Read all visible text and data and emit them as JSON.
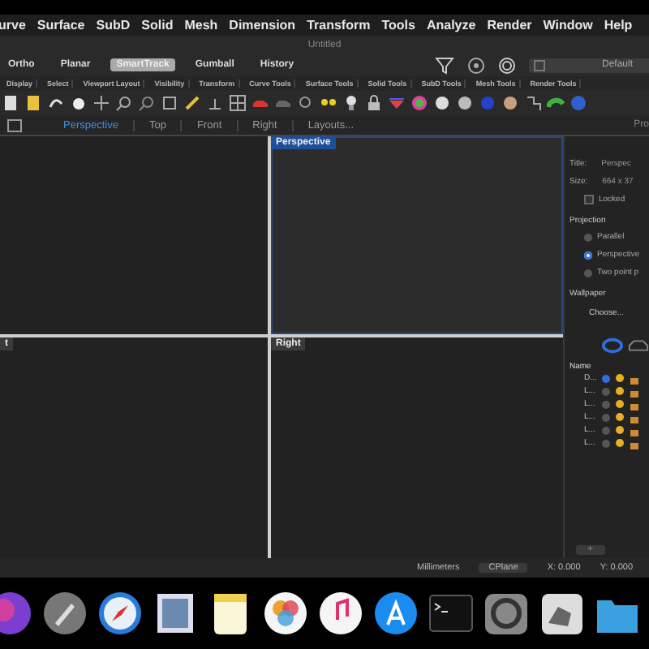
{
  "menu": [
    "urve",
    "Surface",
    "SubD",
    "Solid",
    "Mesh",
    "Dimension",
    "Transform",
    "Tools",
    "Analyze",
    "Render",
    "Window",
    "Help"
  ],
  "window": {
    "title": "Untitled"
  },
  "toolbar": {
    "toggles": [
      {
        "label": "Ortho",
        "selected": false
      },
      {
        "label": "Planar",
        "selected": false
      },
      {
        "label": "SmartTrack",
        "selected": true
      },
      {
        "label": "Gumball",
        "selected": false
      },
      {
        "label": "History",
        "selected": false
      }
    ],
    "layer": "Default"
  },
  "tool_tabs": [
    "Display",
    "Select",
    "Viewport Layout",
    "Visibility",
    "Transform",
    "Curve Tools",
    "Surface Tools",
    "Solid Tools",
    "SubD Tools",
    "Mesh Tools",
    "Render Tools"
  ],
  "viewport_tabs": [
    {
      "label": "Perspective",
      "selected": true
    },
    {
      "label": "Top",
      "selected": false
    },
    {
      "label": "Front",
      "selected": false
    },
    {
      "label": "Right",
      "selected": false
    },
    {
      "label": "Layouts...",
      "selected": false
    }
  ],
  "panel_title": "Pro",
  "viewports": [
    {
      "active": false
    },
    {
      "label": "Perspective",
      "active": true
    },
    {
      "label": "t",
      "active": false
    },
    {
      "label": "Right",
      "active": false
    }
  ],
  "properties": {
    "title_label": "Title:",
    "title_value": "Perspec",
    "size_label": "Size:",
    "size_value": "664 x 37",
    "locked": {
      "label": "Locked",
      "checked": false
    },
    "projection_heading": "Projection",
    "projection": [
      {
        "label": "Parallel",
        "selected": false
      },
      {
        "label": "Perspective",
        "selected": true
      },
      {
        "label": "Two point p",
        "selected": false
      }
    ],
    "wallpaper_heading": "Wallpaper",
    "choose_button": "Choose..."
  },
  "layers": {
    "heading": "Name",
    "rows": [
      {
        "name": "D...",
        "current": true
      },
      {
        "name": "L...",
        "current": false
      },
      {
        "name": "L...",
        "current": false
      },
      {
        "name": "L...",
        "current": false
      },
      {
        "name": "L...",
        "current": false
      },
      {
        "name": "L...",
        "current": false
      }
    ],
    "add_button": "+"
  },
  "status_bar": {
    "units": "Millimeters",
    "cplane": "CPlane",
    "x": "X: 0.000",
    "y": "Y: 0.000"
  }
}
